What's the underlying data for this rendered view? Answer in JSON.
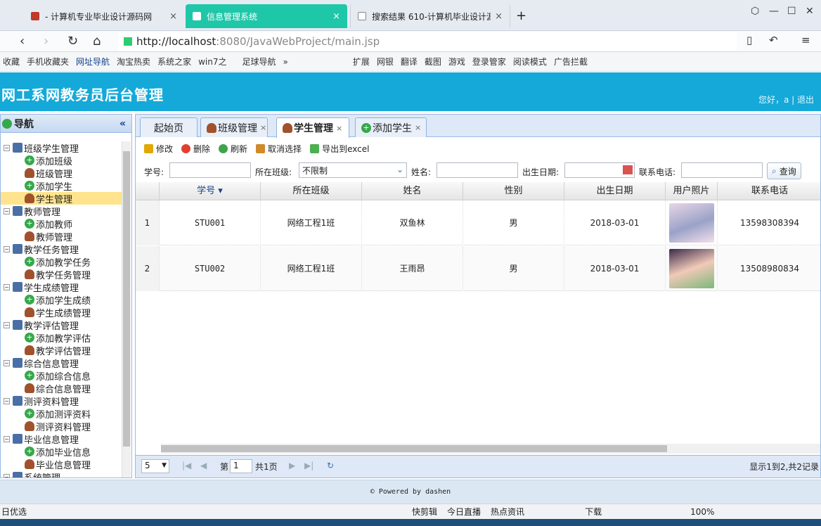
{
  "browser": {
    "tabs": [
      {
        "label": "- 计算机专业毕业设计源码网",
        "close": "×"
      },
      {
        "label": "信息管理系统",
        "close": "×"
      },
      {
        "label": "搜索结果 610-计算机毕业设计源",
        "close": "×"
      }
    ],
    "new_tab": "+",
    "win_controls": [
      "⬡",
      "—",
      "☐",
      "✕"
    ],
    "url_host": "http://localhost",
    "url_rest": ":8080/JavaWebProject/main.jsp",
    "bookmarks": [
      "收藏",
      "手机收藏夹",
      "网址导航",
      "淘宝热卖",
      "系统之家",
      "win7之",
      "足球导航",
      "»",
      "扩展",
      "网银",
      "翻译",
      "截图",
      "游戏",
      "登录管家",
      "阅读模式",
      "广告拦截"
    ]
  },
  "app": {
    "title": "网工系网教务员后台管理",
    "user_text": "您好，a | 退出"
  },
  "sidebar": {
    "title": "导航",
    "collapse": "«",
    "tree": [
      {
        "kind": "cat",
        "label": "班级学生管理"
      },
      {
        "kind": "add",
        "label": "添加班级"
      },
      {
        "kind": "usr",
        "label": "班级管理"
      },
      {
        "kind": "add",
        "label": "添加学生"
      },
      {
        "kind": "usr",
        "label": "学生管理",
        "selected": true
      },
      {
        "kind": "cat",
        "label": "教师管理"
      },
      {
        "kind": "add",
        "label": "添加教师"
      },
      {
        "kind": "usr",
        "label": "教师管理"
      },
      {
        "kind": "cat",
        "label": "教学任务管理"
      },
      {
        "kind": "add",
        "label": "添加教学任务"
      },
      {
        "kind": "usr",
        "label": "教学任务管理"
      },
      {
        "kind": "cat",
        "label": "学生成绩管理"
      },
      {
        "kind": "add",
        "label": "添加学生成绩"
      },
      {
        "kind": "usr",
        "label": "学生成绩管理"
      },
      {
        "kind": "cat",
        "label": "教学评估管理"
      },
      {
        "kind": "add",
        "label": "添加教学评估"
      },
      {
        "kind": "usr",
        "label": "教学评估管理"
      },
      {
        "kind": "cat",
        "label": "综合信息管理"
      },
      {
        "kind": "add",
        "label": "添加综合信息"
      },
      {
        "kind": "usr",
        "label": "综合信息管理"
      },
      {
        "kind": "cat",
        "label": "测评资料管理"
      },
      {
        "kind": "add",
        "label": "添加测评资料"
      },
      {
        "kind": "usr",
        "label": "测评资料管理"
      },
      {
        "kind": "cat",
        "label": "毕业信息管理"
      },
      {
        "kind": "add",
        "label": "添加毕业信息"
      },
      {
        "kind": "usr",
        "label": "毕业信息管理"
      },
      {
        "kind": "cat",
        "label": "系统管理"
      }
    ]
  },
  "main_tabs": [
    {
      "label": "起始页",
      "closable": false
    },
    {
      "label": "班级管理",
      "closable": true
    },
    {
      "label": "学生管理",
      "closable": true,
      "active": true
    },
    {
      "label": "添加学生",
      "closable": true
    }
  ],
  "toolbar": {
    "edit": "修改",
    "delete": "删除",
    "refresh": "刷新",
    "cancel_select": "取消选择",
    "export": "导出到excel"
  },
  "search": {
    "student_no_label": "学号:",
    "class_label": "所在班级:",
    "class_value": "不限制",
    "name_label": "姓名:",
    "birth_label": "出生日期:",
    "phone_label": "联系电话:",
    "query_button": "查询"
  },
  "grid": {
    "headers": [
      "学号 ▾",
      "所在班级",
      "姓名",
      "性别",
      "出生日期",
      "用户照片",
      "联系电话"
    ],
    "rows": [
      {
        "index": "1",
        "student_no": "STU001",
        "class": "网络工程1班",
        "name": "双鱼林",
        "gender": "男",
        "birth": "2018-03-01",
        "phone": "13598308394"
      },
      {
        "index": "2",
        "student_no": "STU002",
        "class": "网络工程1班",
        "name": "王雨昂",
        "gender": "男",
        "birth": "2018-03-01",
        "phone": "13508980834"
      }
    ]
  },
  "pager": {
    "page_size": "5",
    "page_label": "第",
    "page_value": "1",
    "total_pages": "共1页",
    "summary": "显示1到2,共2记录"
  },
  "footer": "© Powered by dashen",
  "statusbar": [
    "日优选",
    "快剪辑",
    "今日直播",
    "热点资讯",
    "下载",
    "100%"
  ],
  "colors": {
    "header": "#14a9d8",
    "active_browser_tab": "#1fc7a9",
    "selected_tree": "#ffe48d"
  }
}
